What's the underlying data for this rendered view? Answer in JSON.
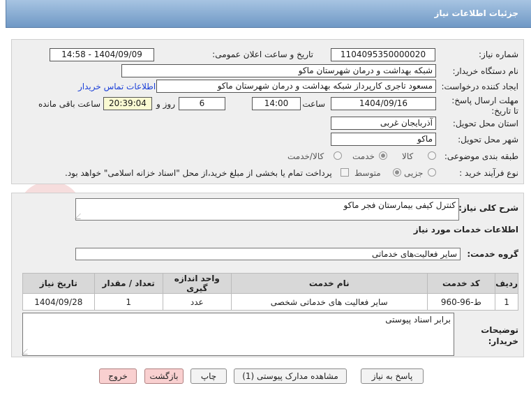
{
  "header": {
    "title": "جزئیات اطلاعات نیاز"
  },
  "watermark": {
    "text": "AriaTender.net"
  },
  "form": {
    "need_number_label": "شماره نیاز:",
    "need_number": "1104095350000020",
    "announce_label": "تاریخ و ساعت اعلان عمومی:",
    "announce_value": "1404/09/09 - 14:58",
    "buyer_org_label": "نام دستگاه خریدار:",
    "buyer_org": "شبکه بهداشت و درمان شهرستان ماکو",
    "creator_label": "ایجاد کننده درخواست:",
    "creator": "مسعود تاجری کارپرداز شبکه بهداشت و درمان شهرستان ماکو",
    "contact_link": "اطلاعات تماس خریدار",
    "deadline_label": "مهلت ارسال پاسخ: تا تاریخ:",
    "deadline_date": "1404/09/16",
    "time_label": "ساعت",
    "deadline_time": "14:00",
    "days_value": "6",
    "days_label": "روز و",
    "remaining_time": "20:39:04",
    "remaining_label": "ساعت باقی مانده",
    "province_label": "استان محل تحویل:",
    "province": "آذربایجان غربی",
    "city_label": "شهر محل تحویل:",
    "city": "ماکو",
    "category_label": "طبقه بندی موضوعی:",
    "category_options": [
      "کالا",
      "خدمت",
      "کالا/خدمت"
    ],
    "process_label": "نوع فرآیند خرید :",
    "process_options": [
      "جزیی",
      "متوسط"
    ],
    "payment_note": "پرداخت تمام یا بخشی از مبلغ خرید،از محل \"اسناد خزانه اسلامی\" خواهد بود."
  },
  "summary": {
    "label": "شرح کلی نیاز:",
    "value": "کنترل کیفی بیمارستان فجر ماکو",
    "services_heading": "اطلاعات خدمات مورد نیاز",
    "group_label": "گروه خدمت:",
    "group_value": "سایر فعالیت‌های خدماتی"
  },
  "table": {
    "headers": [
      "ردیف",
      "کد خدمت",
      "نام خدمت",
      "واحد اندازه گیری",
      "تعداد / مقدار",
      "تاریخ نیاز"
    ],
    "rows": [
      [
        "1",
        "ط-96-960",
        "سایر فعالیت های خدماتی شخصی",
        "عدد",
        "1",
        "1404/09/28"
      ]
    ]
  },
  "buyer_notes": {
    "label": "توضیحات خریدار:",
    "value": "برابر اسناد پیوستی"
  },
  "buttons": {
    "reply": "پاسخ به نیاز",
    "attachments": "مشاهده مدارک پیوستی (1)",
    "print": "چاپ",
    "back": "بازگشت",
    "exit": "خروج"
  }
}
